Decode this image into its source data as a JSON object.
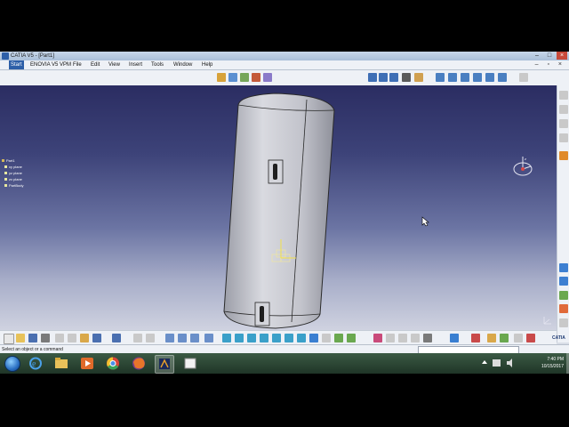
{
  "window": {
    "title": "CATIA V5 - [Part1]",
    "controls": [
      "–",
      "□",
      "×"
    ]
  },
  "menubar": {
    "items": [
      "Start",
      "ENOVIA V5 VPM",
      "File",
      "Edit",
      "View",
      "Insert",
      "Tools",
      "Window",
      "Help"
    ],
    "mdi_controls": "– ▫ ×"
  },
  "tree": {
    "root": "Part1",
    "children": [
      "xy plane",
      "yz plane",
      "zx plane",
      "PartBody"
    ]
  },
  "compass": {
    "labels": [
      "x",
      "y",
      "z"
    ]
  },
  "status": {
    "message": "Select an object or a command",
    "command_value": ""
  },
  "brand": "CATIA",
  "taskbar": {
    "apps": [
      "windows-explorer",
      "internet-explorer",
      "file-explorer",
      "media-player",
      "chrome",
      "firefox",
      "catia",
      "app-window"
    ],
    "clock_time": "7:40 PM",
    "clock_date": "10/15/2017"
  },
  "colors": {
    "viewport_top": "#2b2d62",
    "viewport_bottom": "#cfd2e0",
    "part_body": "#c8c9d2",
    "toolbar_bg": "#eef1f6",
    "taskbar": "#2a4433"
  }
}
